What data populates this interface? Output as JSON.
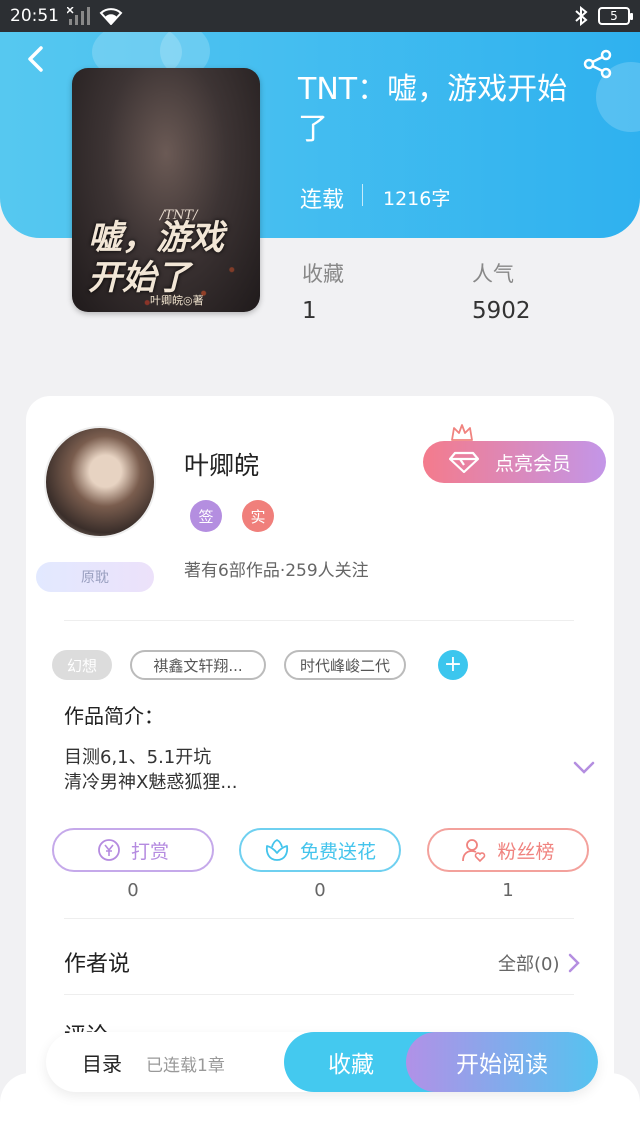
{
  "status_bar": {
    "time": "20:51",
    "battery": "5"
  },
  "book": {
    "title": "TNT：嘘，游戏开始了",
    "status": "连载",
    "word_count": "1216字",
    "cover": {
      "subtitle": "/TNT/",
      "title": "嘘，游戏开始了",
      "author": "叶卿皖◎著"
    },
    "stats": {
      "favorites_label": "收藏",
      "favorites_value": "1",
      "popularity_label": "人气",
      "popularity_value": "5902"
    }
  },
  "author": {
    "name": "叶卿皖",
    "badge": "原耽",
    "tags": [
      "签",
      "实"
    ],
    "stats": "著有6部作品·259人关注",
    "vip_button": "点亮会员"
  },
  "tags": [
    "幻想",
    "祺鑫文轩翔...",
    "时代峰峻二代"
  ],
  "intro": {
    "heading": "作品简介：",
    "lines": [
      "目测6,1、5.1开坑",
      "清冷男神X魅惑狐狸..."
    ]
  },
  "actions": [
    {
      "label": "打赏",
      "count": "0",
      "icon": "yen-icon",
      "color": "#b58be0"
    },
    {
      "label": "免费送花",
      "count": "0",
      "icon": "flower-icon",
      "color": "#44c4ec"
    },
    {
      "label": "粉丝榜",
      "count": "1",
      "icon": "user-heart-icon",
      "color": "#f0837f"
    }
  ],
  "author_says": {
    "title": "作者说",
    "all": "全部(0)"
  },
  "comments": {
    "title": "评论"
  },
  "bottom_bar": {
    "toc": "目录",
    "toc_sub": "已连载1章",
    "favorite": "收藏",
    "read": "开始阅读"
  },
  "colors": {
    "header": "#3db9f0",
    "accent_blue": "#44c9ef",
    "accent_purple": "#b191e7",
    "vip_pink": "#f47b8c"
  }
}
